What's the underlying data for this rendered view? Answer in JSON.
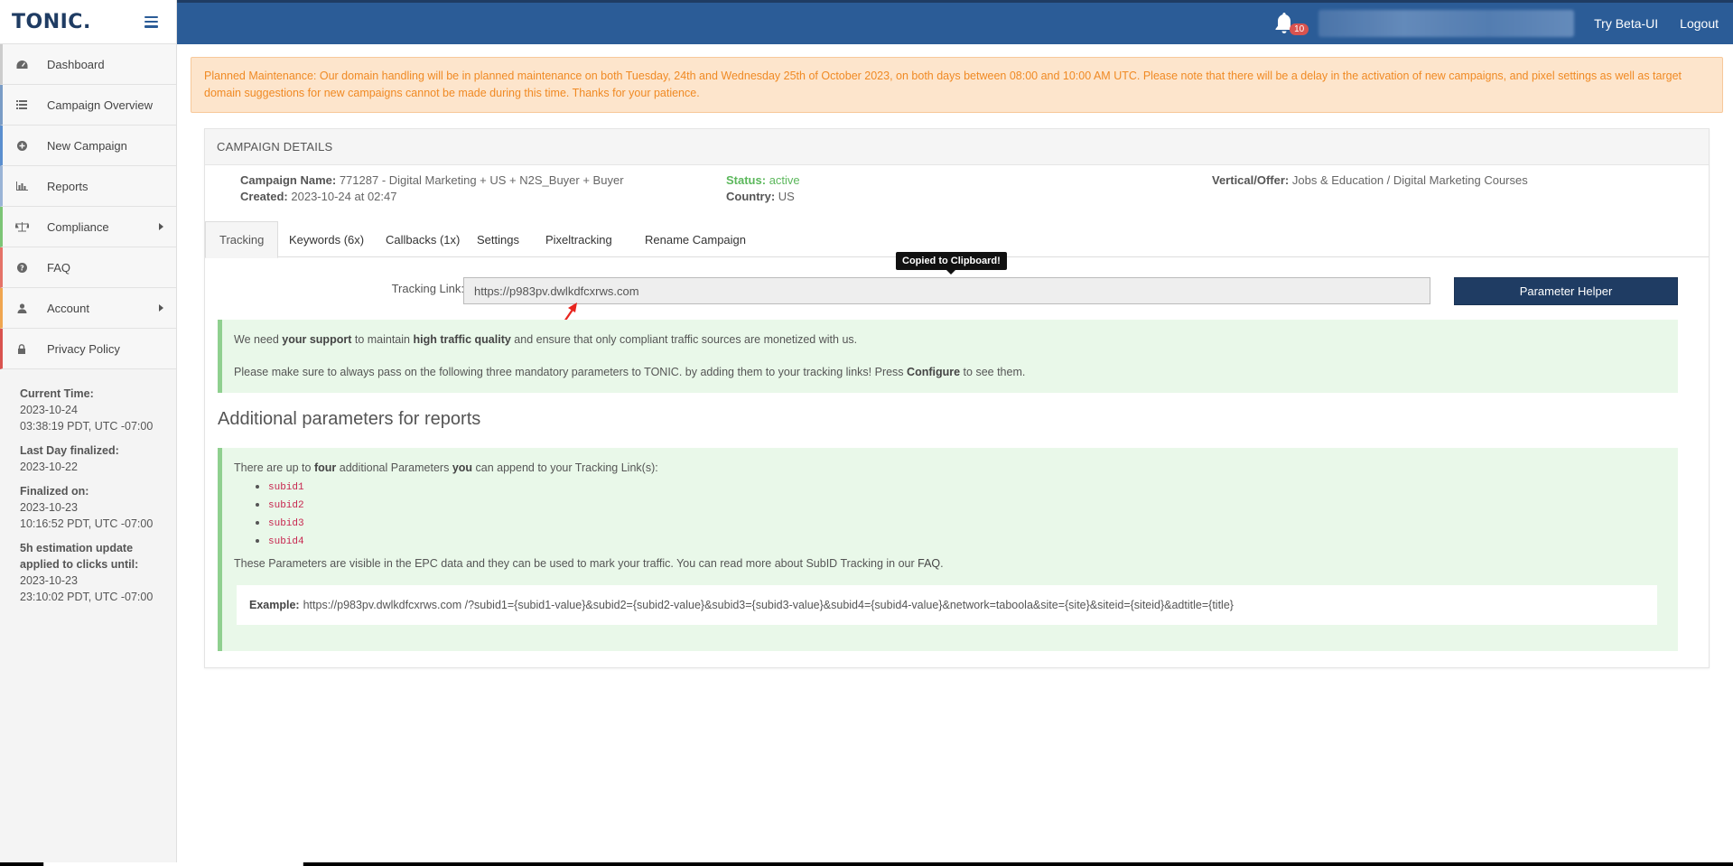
{
  "brand": {
    "logo": "TONIC."
  },
  "sidebar": {
    "items": [
      {
        "label": "Dashboard",
        "icon": "dashboard-icon",
        "accent": "#cccccc"
      },
      {
        "label": "Campaign Overview",
        "icon": "list-icon",
        "accent": "#7a9cc6"
      },
      {
        "label": "New Campaign",
        "icon": "plus-circle-icon",
        "accent": "#5b8fcf"
      },
      {
        "label": "Reports",
        "icon": "bar-chart-icon",
        "accent": "#9ab4d6"
      },
      {
        "label": "Compliance",
        "icon": "balance-scale-icon",
        "accent": "#7cc576"
      },
      {
        "label": "FAQ",
        "icon": "question-circle-icon",
        "accent": "#e57368"
      },
      {
        "label": "Account",
        "icon": "user-icon",
        "accent": "#f0a650"
      },
      {
        "label": "Privacy Policy",
        "icon": "lock-icon",
        "accent": "#d9534f"
      }
    ],
    "info": {
      "current_time_label": "Current Time:",
      "current_time_date": "2023-10-24",
      "current_time_time": "03:38:19 PDT, UTC -07:00",
      "last_day_label": "Last Day finalized:",
      "last_day_value": "2023-10-22",
      "finalized_label": "Finalized on:",
      "finalized_date": "2023-10-23",
      "finalized_time": "10:16:52 PDT, UTC -07:00",
      "estimation_label_1": "5h estimation update",
      "estimation_label_2": "applied to clicks until:",
      "estimation_date": "2023-10-23",
      "estimation_time": "23:10:02 PDT, UTC -07:00"
    }
  },
  "topbar": {
    "notification_count": "10",
    "try_beta": "Try Beta-UI",
    "logout": "Logout"
  },
  "maintenance": {
    "text": "Planned Maintenance: Our domain handling will be in planned maintenance on both Tuesday, 24th and Wednesday 25th of October 2023, on both days between 08:00 and 10:00 AM UTC. Please note that there will be a delay in the activation of new campaigns, and pixel settings as well as target domain suggestions for new campaigns cannot be made during this time. Thanks for your patience."
  },
  "campaign": {
    "heading": "CAMPAIGN DETAILS",
    "name_label": "Campaign Name:",
    "name_value": "771287 - Digital Marketing + US + N2S_Buyer + Buyer",
    "created_label": "Created:",
    "created_value": "2023-10-24 at 02:47",
    "status_label": "Status:",
    "status_value": "active",
    "country_label": "Country:",
    "country_value": "US",
    "vertical_label": "Vertical/Offer:",
    "vertical_value": "Jobs & Education / Digital Marketing Courses"
  },
  "tabs": [
    {
      "label": "Tracking",
      "active": true
    },
    {
      "label": "Keywords (6x)"
    },
    {
      "label": "Callbacks (1x)"
    },
    {
      "label": "Settings"
    },
    {
      "label": "Pixeltracking"
    },
    {
      "label": "Rename Campaign"
    }
  ],
  "tracking": {
    "label": "Tracking Link:",
    "value": "https://p983pv.dwlkdfcxrws.com",
    "tooltip": "Copied to Clipboard!",
    "helper_button": "Parameter Helper"
  },
  "support_box": {
    "l1_a": "We need ",
    "l1_b": "your support",
    "l1_c": " to maintain ",
    "l1_d": "high traffic quality",
    "l1_e": " and ensure that only compliant traffic sources are monetized with us.",
    "l2_a": "Please make sure to always pass on the following three mandatory parameters to TONIC. by adding them to your tracking links! Press ",
    "l2_b": "Configure",
    "l2_c": " to see them."
  },
  "additional": {
    "heading": "Additional parameters for reports",
    "intro_a": "There are up to ",
    "intro_b": "four",
    "intro_c": " additional Parameters ",
    "intro_d": "you",
    "intro_e": " can append to your Tracking Link(s):",
    "params": [
      "subid1",
      "subid2",
      "subid3",
      "subid4"
    ],
    "note_a": "These Parameters are visible in the EPC data and they can be used to mark your traffic. You can read more about SubID Tracking in our ",
    "note_b": "FAQ",
    "note_c": ".",
    "example_label": "Example:",
    "example_value": "https://p983pv.dwlkdfcxrws.com /?subid1={subid1-value}&subid2={subid2-value}&subid3={subid3-value}&subid4={subid4-value}&network=taboola&site={site}&siteid={siteid}&adtitle={title}"
  },
  "colors": {
    "topbar": "#2b5c97",
    "brand_dark": "#1f3c63",
    "alert_bg": "#fde5cc",
    "alert_text": "#f08a24",
    "success_bg": "#e9f8e9",
    "status_active": "#5cb85c",
    "badge": "#d9534f"
  }
}
